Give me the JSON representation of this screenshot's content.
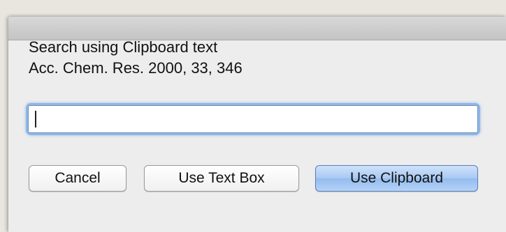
{
  "dialog": {
    "message_line1": "Search using Clipboard text",
    "message_line2": "Acc. Chem. Res. 2000, 33, 346",
    "input_value": "",
    "buttons": {
      "cancel": "Cancel",
      "use_text_box": "Use Text Box",
      "use_clipboard": "Use Clipboard"
    },
    "colors": {
      "focus_ring": "#8fb6e6",
      "default_button": "#a9c9f3",
      "window_bg": "#ededed"
    }
  }
}
